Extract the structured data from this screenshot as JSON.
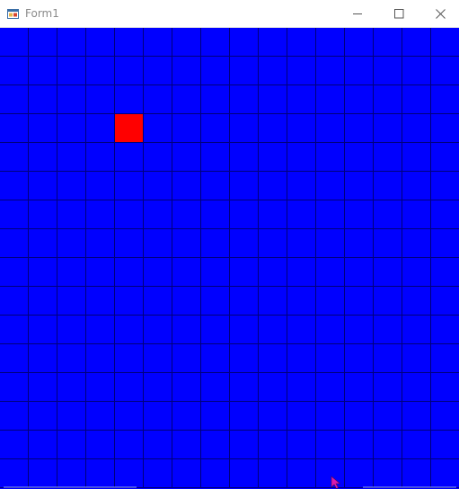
{
  "window": {
    "title": "Form1"
  },
  "titlebar": {
    "app_icon": "winforms-app-icon",
    "minimize_icon": "minimize-icon",
    "maximize_icon": "maximize-icon",
    "close_icon": "close-icon"
  },
  "board": {
    "background_color": "#0000ff",
    "line_color": "#00007a",
    "highlight_color": "#ff0000",
    "columns": 16,
    "rows": 16,
    "highlighted_cell": {
      "column": 4,
      "row": 3
    }
  },
  "cursor": {
    "icon": "mouse-pointer-icon",
    "color": "#d81bb0"
  }
}
